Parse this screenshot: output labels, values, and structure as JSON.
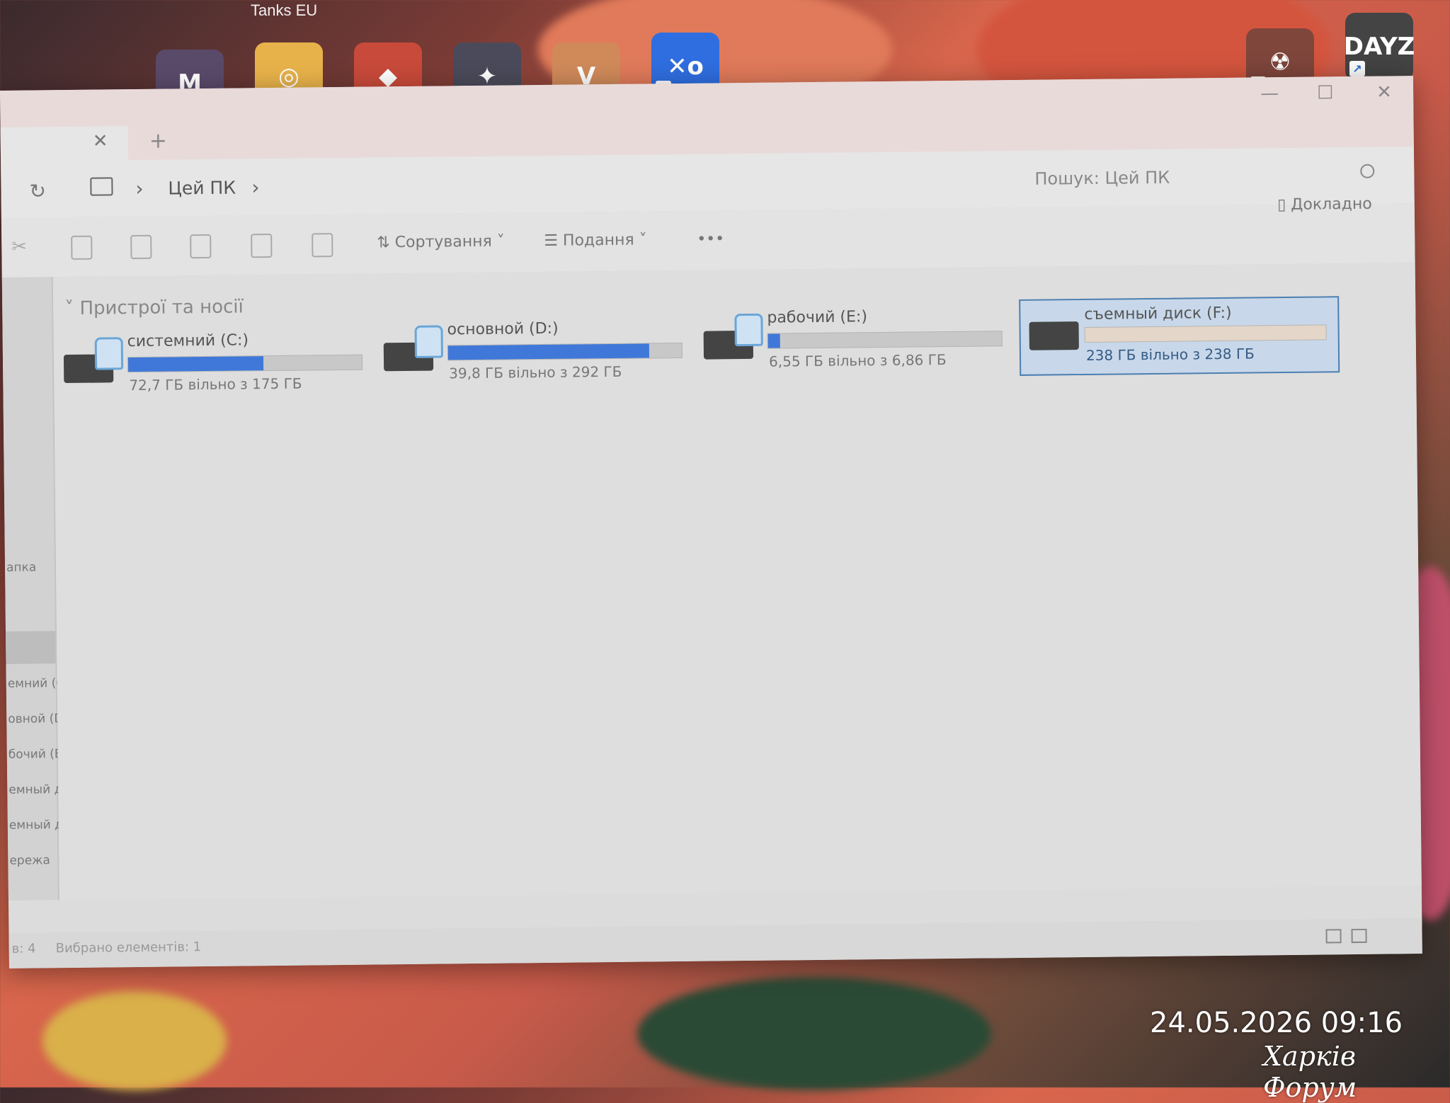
{
  "desktop": {
    "top_label": "Tanks EU",
    "dayz_label": "DAYZ",
    "timestamp": "24.05.2026 09:16",
    "watermark": "Харків Форум"
  },
  "window": {
    "tab_close": "✕",
    "tab_add": "+",
    "minimize": "—",
    "maximize": "☐",
    "close": "✕"
  },
  "address": {
    "refresh": "↻",
    "sep": "›",
    "crumb": "Цей ПК",
    "search_placeholder": "Пошук: Цей ПК"
  },
  "toolbar": {
    "sort_label": "Сортування",
    "view_label": "Подання",
    "more": "•••",
    "details_label": "Докладно"
  },
  "sidebar": {
    "items": [
      "апка",
      "емний (C",
      "овной (D:)",
      "бочий (E:)",
      "емный диск",
      "емный диск",
      "ережа"
    ]
  },
  "content": {
    "group_label": "Пристрої та носії",
    "drives": [
      {
        "name": "системний (C:)",
        "info": "72,7 ГБ вільно з 175 ГБ",
        "used_fraction": 0.58
      },
      {
        "name": "основной (D:)",
        "info": "39,8 ГБ вільно з 292 ГБ",
        "used_fraction": 0.86
      },
      {
        "name": "рабочий (E:)",
        "info": "6,55 ГБ вільно з 6,86 ГБ",
        "used_fraction": 0.05
      },
      {
        "name": "съемный диск  (F:)",
        "info": "238 ГБ вільно з 238 ГБ",
        "used_fraction": 0.0
      }
    ]
  },
  "status": {
    "count": "в: 4",
    "selected": "Вибрано елементів: 1"
  },
  "colors": {
    "accent": "#3f78d8",
    "selection": "#c8d8ea"
  }
}
